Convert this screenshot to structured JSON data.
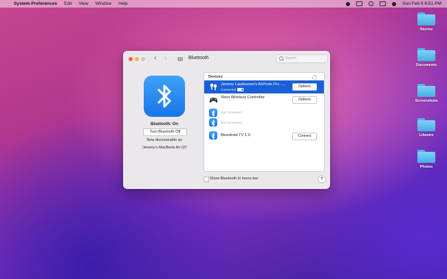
{
  "menubar": {
    "app_name": "System Preferences",
    "menus": [
      "Edit",
      "View",
      "Window",
      "Help"
    ],
    "clock": "Sun Feb 6  6:51 PM"
  },
  "desktop": {
    "icons": [
      {
        "label": "Stories"
      },
      {
        "label": "Documents"
      },
      {
        "label": "Screenshots"
      },
      {
        "label": "Lifewire"
      },
      {
        "label": "Photos"
      }
    ]
  },
  "window": {
    "title": "Bluetooth",
    "search_placeholder": "Search"
  },
  "bluetooth": {
    "status": "Bluetooth: On",
    "toggle_label": "Turn Bluetooth Off",
    "discoverable": "Now discoverable as",
    "device_name": "“Jeremy's MacBook Air (2)”"
  },
  "devices": {
    "header": "Devices",
    "items": [
      {
        "name": "Jeremy Laukkonen's AirPods Pro -...",
        "status": "Connected",
        "action": "Options",
        "icon": "airpods-icon",
        "selected": true
      },
      {
        "name": "Xbox Wireless Controller",
        "status": "",
        "action": "Options",
        "icon": "gamepad-icon",
        "selected": false
      },
      {
        "name": "",
        "status": "Not Connected",
        "action": "",
        "icon": "bluetooth-icon",
        "selected": false
      },
      {
        "name": "",
        "status": "Not Connected",
        "action": "",
        "icon": "bluetooth-icon",
        "selected": false
      },
      {
        "name": "Bluedroid TV 1.0",
        "status": "",
        "action": "Connect",
        "icon": "bluetooth-icon",
        "selected": false
      }
    ]
  },
  "footer": {
    "show_in_menu_bar": "Show Bluetooth in menu bar",
    "help": "?"
  },
  "colors": {
    "accent": "#1a5fd5",
    "bluetooth_blue": "#1776e8"
  }
}
